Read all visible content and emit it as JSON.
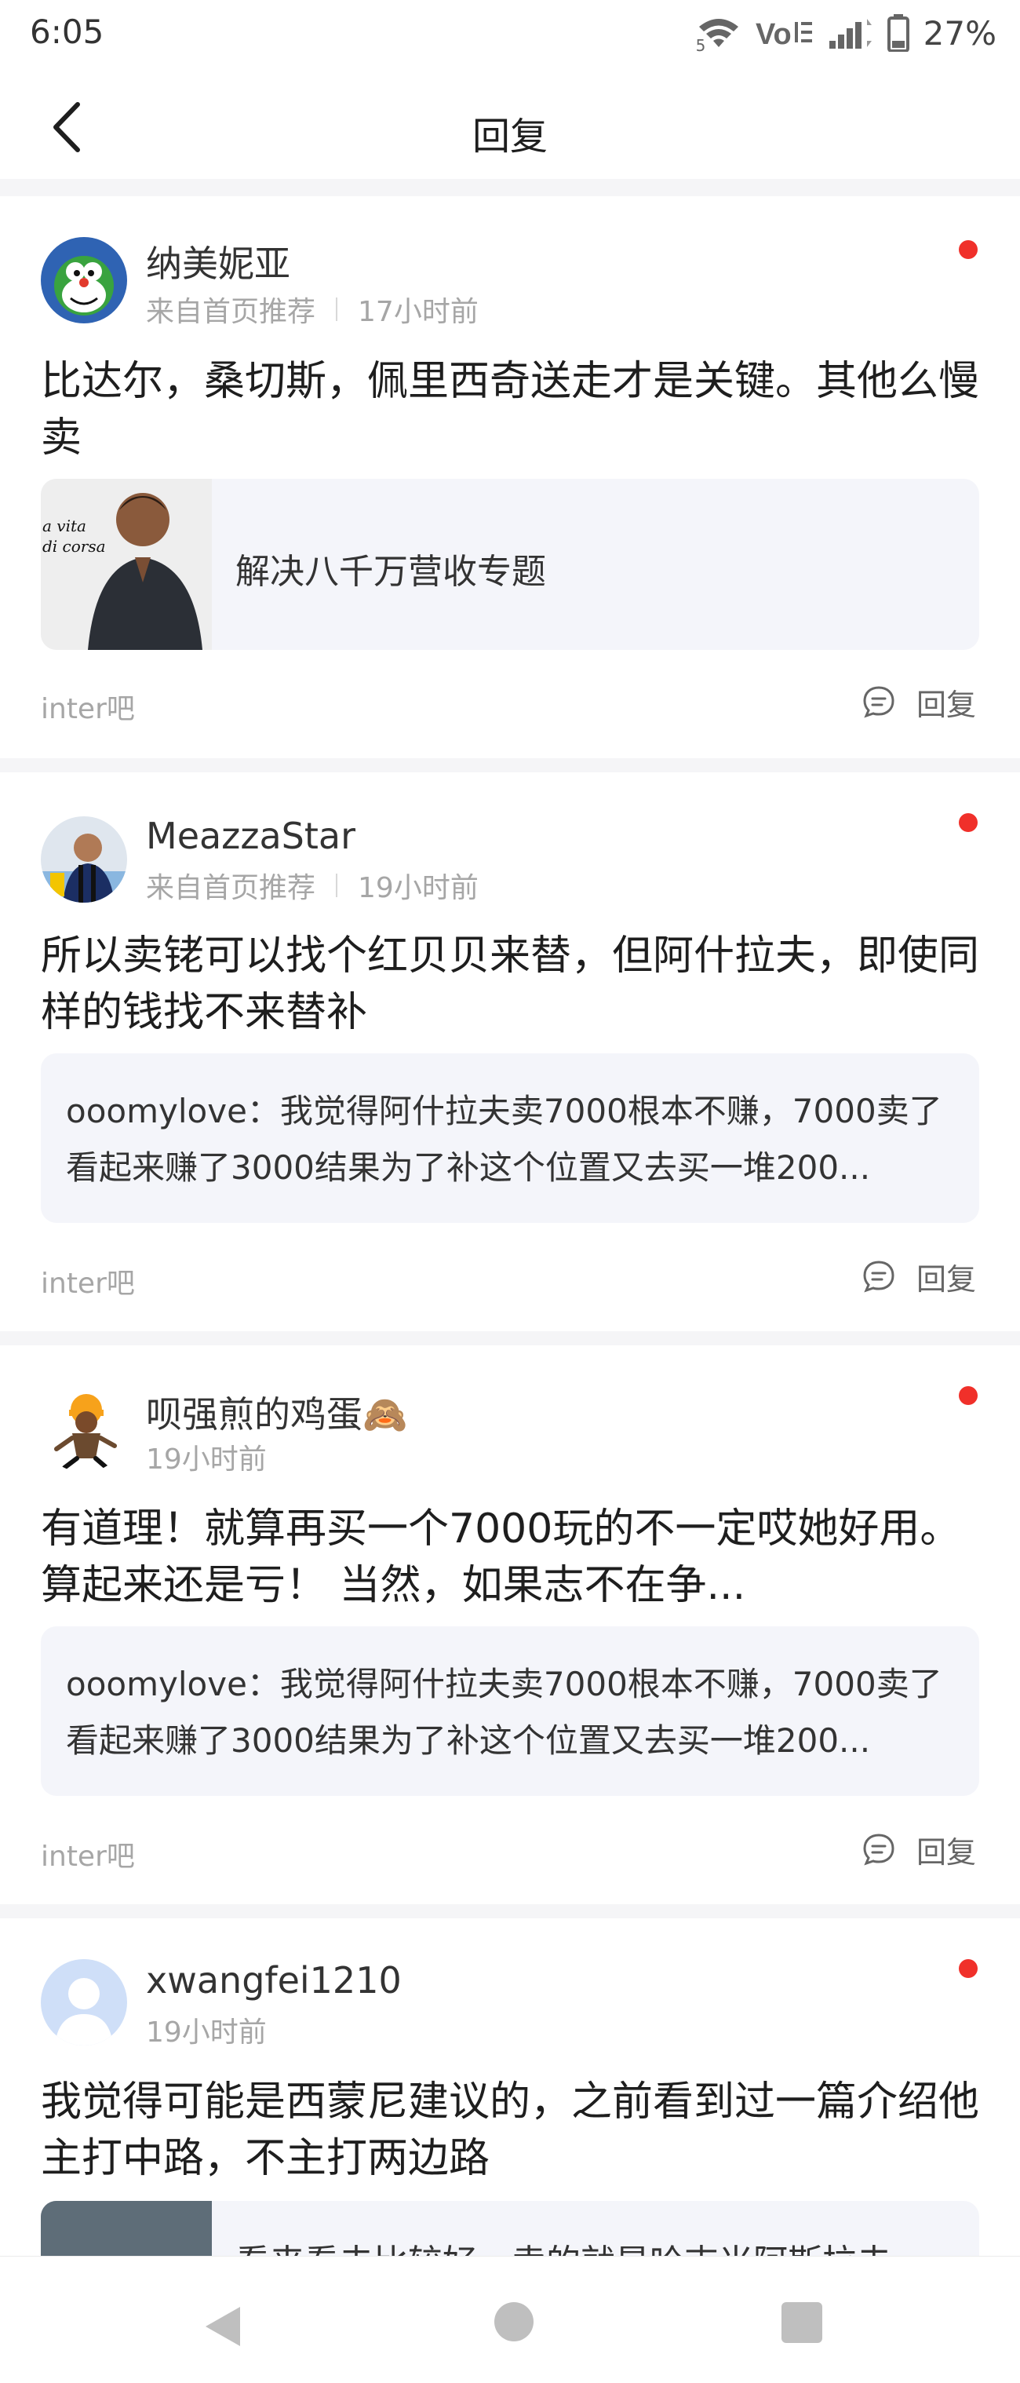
{
  "status_bar": {
    "time": "6:05",
    "battery": "27%",
    "wifi_badge": "5",
    "icons": [
      "wifi-icon",
      "volte-icon",
      "signal-icon",
      "battery-icon"
    ]
  },
  "header": {
    "title": "回复",
    "back_icon": "chevron-left-icon"
  },
  "posts": [
    {
      "username": "纳美妮亚",
      "source": "来自首页推荐",
      "time": "17小时前",
      "content": "比达尔，桑切斯，佩里西奇送走才是关键。其他么慢卖",
      "quote": {
        "type": "link",
        "title": "解决八千万营收专题",
        "thumb_text_1": "a vita",
        "thumb_text_2": "di corsa"
      },
      "forum": "inter吧",
      "reply_label": "回复"
    },
    {
      "username": "MeazzaStar",
      "source": "来自首页推荐",
      "time": "19小时前",
      "content": "所以卖铑可以找个红贝贝来替，但阿什拉夫，即使同样的钱找不来替补",
      "quote": {
        "type": "text",
        "text": "ooomylove：我觉得阿什拉夫卖7000根本不赚，7000卖了看起来赚了3000结果为了补这个位置又去买一堆200..."
      },
      "forum": "inter吧",
      "reply_label": "回复"
    },
    {
      "username": "呗强煎的鸡蛋🙈",
      "source": "",
      "time": "19小时前",
      "content": "有道理！就算再买一个7000玩的不一定哎她好用。算起来还是亏！ 当然，如果志不在争...",
      "quote": {
        "type": "text",
        "text": "ooomylove：我觉得阿什拉夫卖7000根本不赚，7000卖了看起来赚了3000结果为了补这个位置又去买一堆200..."
      },
      "forum": "inter吧",
      "reply_label": "回复"
    },
    {
      "username": "xwangfei1210",
      "source": "",
      "time": "19小时前",
      "content": "我觉得可能是西蒙尼建议的，之前看到过一篇介绍他主打中路，不主打两边路",
      "quote": {
        "type": "link",
        "title": "看来看去比较好，卖的就是哈吉米阿斯拉夫"
      },
      "forum": "",
      "reply_label": ""
    }
  ],
  "colors": {
    "accent_red": "#f0302a",
    "meta_gray": "#a6a6a6",
    "quote_bg": "#f4f5fa",
    "divider": "#f5f5f7"
  },
  "system_nav": [
    "back-triangle-icon",
    "home-circle-icon",
    "recents-square-icon"
  ]
}
